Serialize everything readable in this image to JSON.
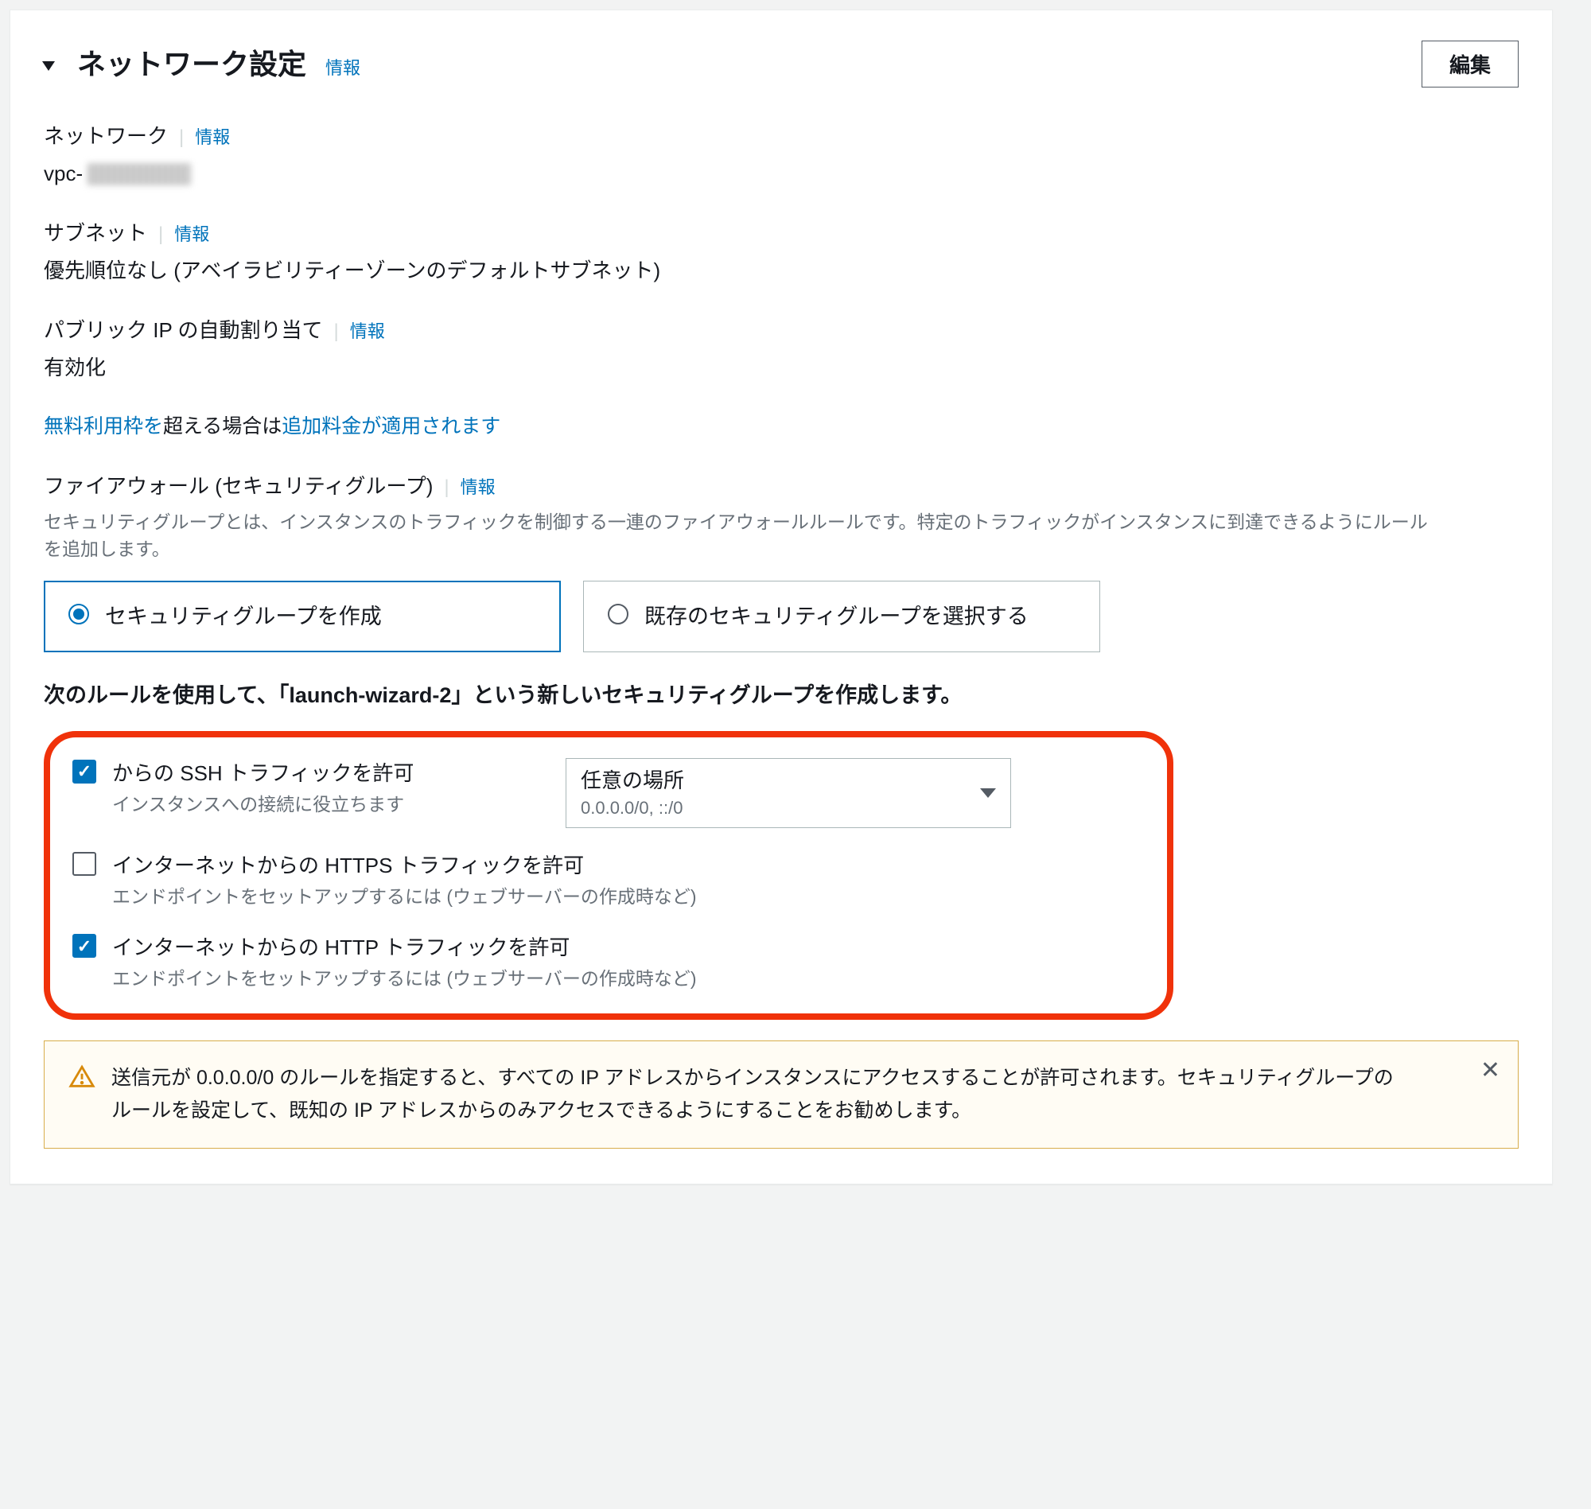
{
  "panel": {
    "title": "ネットワーク設定",
    "info_label": "情報",
    "edit_button": "編集"
  },
  "fields": {
    "network": {
      "label": "ネットワーク",
      "value_prefix": "vpc-"
    },
    "subnet": {
      "label": "サブネット",
      "value": "優先順位なし (アベイラビリティーゾーンのデフォルトサブネット)"
    },
    "public_ip": {
      "label": "パブリック IP の自動割り当て",
      "value": "有効化"
    },
    "free_tier": {
      "link1": "無料利用枠を",
      "mid": "超える場合は",
      "link2": "追加料金が適用されます"
    },
    "firewall": {
      "label": "ファイアウォール (セキュリティグループ)",
      "desc": "セキュリティグループとは、インスタンスのトラフィックを制御する一連のファイアウォールルールです。特定のトラフィックがインスタンスに到達できるようにルールを追加します。"
    }
  },
  "sg_options": {
    "create": "セキュリティグループを作成",
    "select_existing": "既存のセキュリティグループを選択する"
  },
  "rules_intro": "次のルールを使用して、「launch-wizard-2」という新しいセキュリティグループを作成します。",
  "rules": {
    "ssh": {
      "label": "からの SSH トラフィックを許可",
      "hint": "インスタンスへの接続に役立ちます",
      "source_label": "任意の場所",
      "source_value": "0.0.0.0/0, ::/0"
    },
    "https": {
      "label": "インターネットからの HTTPS トラフィックを許可",
      "hint": "エンドポイントをセットアップするには (ウェブサーバーの作成時など)"
    },
    "http": {
      "label": "インターネットからの HTTP トラフィックを許可",
      "hint": "エンドポイントをセットアップするには (ウェブサーバーの作成時など)"
    }
  },
  "alert": "送信元が 0.0.0.0/0 のルールを指定すると、すべての IP アドレスからインスタンスにアクセスすることが許可されます。セキュリティグループのルールを設定して、既知の IP アドレスからのみアクセスできるようにすることをお勧めします。"
}
